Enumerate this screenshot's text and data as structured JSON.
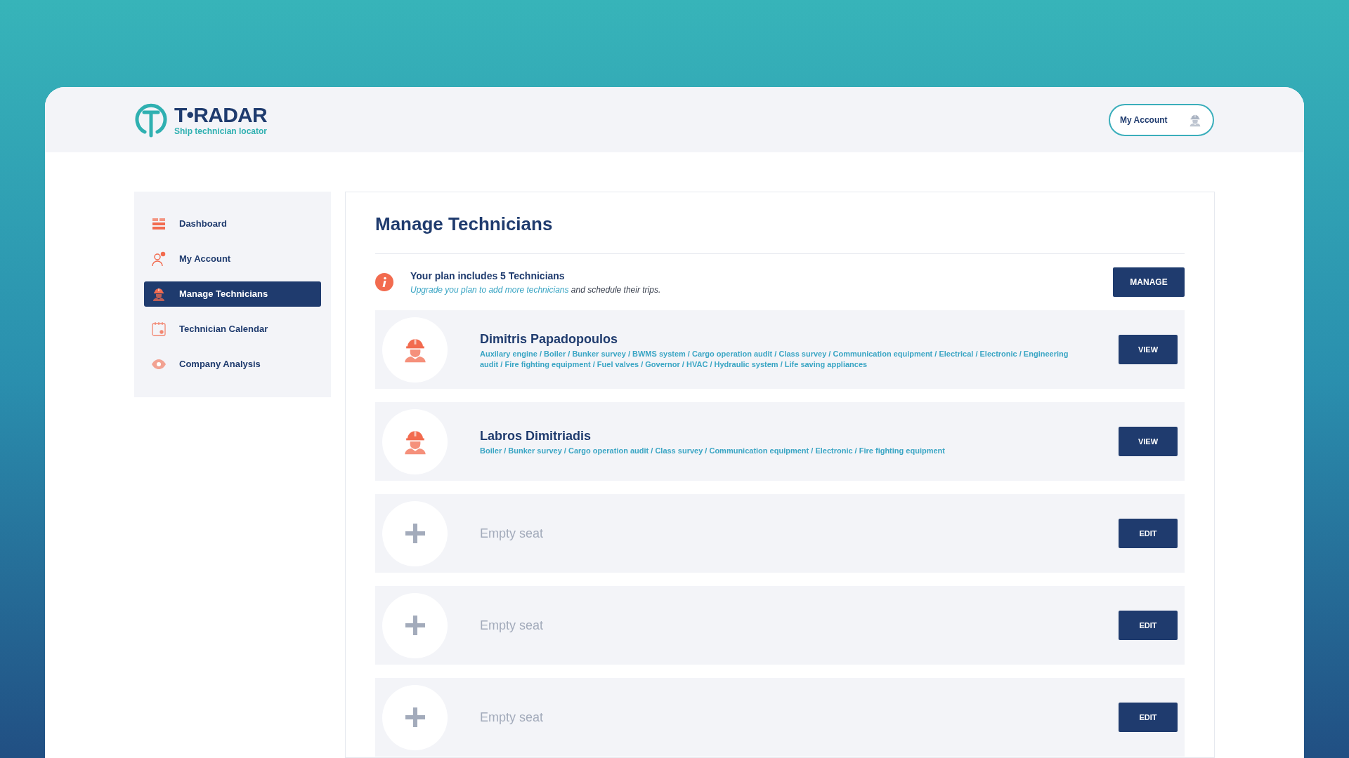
{
  "header": {
    "logo_text": "T•RADAR",
    "tagline": "Ship technician locator",
    "account_button": "My Account"
  },
  "sidebar": {
    "items": [
      {
        "label": "Dashboard",
        "selected": false
      },
      {
        "label": "My Account",
        "selected": false
      },
      {
        "label": "Manage Technicians",
        "selected": true
      },
      {
        "label": "Technician Calendar",
        "selected": false
      },
      {
        "label": "Company Analysis",
        "selected": false
      }
    ]
  },
  "main": {
    "title": "Manage Technicians",
    "plan": {
      "headline": "Your plan includes 5 Technicians",
      "link": "Upgrade you plan to add more technicians",
      "rest": "and schedule their trips.",
      "button": "MANAGE"
    },
    "seats": [
      {
        "kind": "technician",
        "name": "Dimitris Papadopoulos",
        "skills": "Auxilary engine / Boiler / Bunker survey / BWMS system / Cargo operation audit / Class survey / Communication equipment / Electrical / Electronic / Engineering audit / Fire fighting equipment / Fuel valves / Governor / HVAC / Hydraulic system / Life saving appliances",
        "button": "VIEW"
      },
      {
        "kind": "technician",
        "name": "Labros Dimitriadis",
        "skills": "Boiler / Bunker survey / Cargo operation audit / Class survey / Communication equipment / Electronic / Fire fighting equipment",
        "button": "VIEW"
      },
      {
        "kind": "empty",
        "name": "Empty seat",
        "button": "EDIT"
      },
      {
        "kind": "empty",
        "name": "Empty seat",
        "button": "EDIT"
      },
      {
        "kind": "empty",
        "name": "Empty seat",
        "button": "EDIT"
      }
    ]
  }
}
